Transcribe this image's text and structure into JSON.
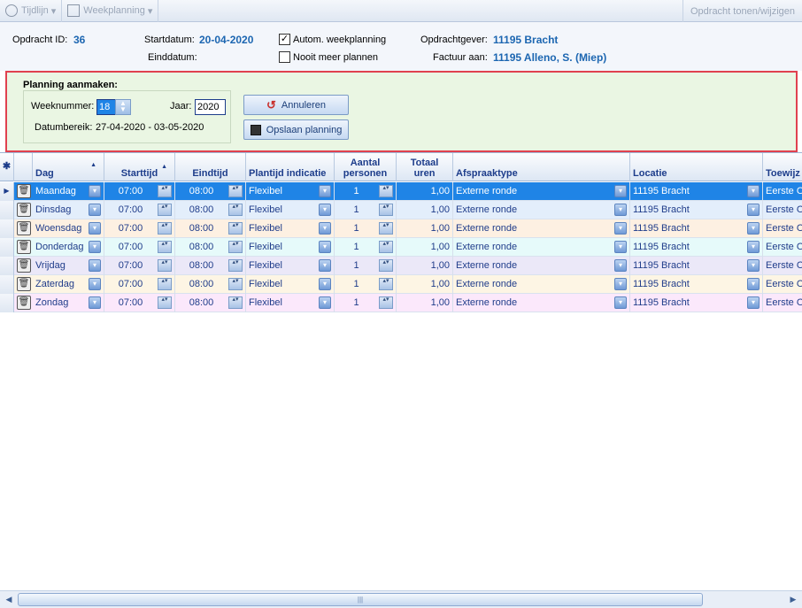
{
  "toolbar": {
    "tijdlijn": "Tijdlijn",
    "weekplanning": "Weekplanning",
    "dropdown_arrow": "▾",
    "opdracht_tonen": "Opdracht tonen/wijzigen"
  },
  "header": {
    "opdracht_id_label": "Opdracht ID:",
    "opdracht_id": "36",
    "startdatum_label": "Startdatum:",
    "startdatum": "20-04-2020",
    "einddatum_label": "Einddatum:",
    "einddatum": "",
    "autom_weekplanning": "Autom. weekplanning",
    "autom_checked": "✓",
    "nooit_meer_plannen": "Nooit meer plannen",
    "opdrachtgever_label": "Opdrachtgever:",
    "opdrachtgever": "11195 Bracht",
    "factuur_label": "Factuur aan:",
    "factuur": "11195 Alleno, S.  (Miep)"
  },
  "planning": {
    "title": "Planning aanmaken:",
    "weeknummer_label": "Weeknummer:",
    "weeknummer": "18",
    "jaar_label": "Jaar:",
    "jaar": "2020",
    "datumbereik_label": "Datumbereik:",
    "datumbereik": "27-04-2020 - 03-05-2020",
    "annuleren": "Annuleren",
    "opslaan": "Opslaan planning"
  },
  "grid": {
    "columns": {
      "dag": "Dag",
      "starttijd": "Starttijd",
      "eindtijd": "Eindtijd",
      "plantijd": "Plantijd indicatie",
      "aantal_1": "Aantal",
      "aantal_2": "personen",
      "totaal_1": "Totaal",
      "totaal_2": "uren",
      "afspraaktype": "Afspraaktype",
      "locatie": "Locatie",
      "toewijzing": "Toewijz"
    },
    "corner_icon": "✱",
    "sort_icon": "▲",
    "row_pointer": "▶",
    "trash_icon": "🗑",
    "dropdown_icon": "▾",
    "spin_icon": "▴▾",
    "rows": [
      {
        "dag": "Maandag",
        "start": "07:00",
        "eind": "08:00",
        "plantijd": "Flexibel",
        "aantal": "1",
        "uren": "1,00",
        "afspraak": "Externe ronde",
        "locatie": "11195 Bracht",
        "toewijzing": "Eerste O",
        "bg": "#1f84e6"
      },
      {
        "dag": "Dinsdag",
        "start": "07:00",
        "eind": "08:00",
        "plantijd": "Flexibel",
        "aantal": "1",
        "uren": "1,00",
        "afspraak": "Externe ronde",
        "locatie": "11195 Bracht",
        "toewijzing": "Eerste O",
        "bg": "#e3eefb"
      },
      {
        "dag": "Woensdag",
        "start": "07:00",
        "eind": "08:00",
        "plantijd": "Flexibel",
        "aantal": "1",
        "uren": "1,00",
        "afspraak": "Externe ronde",
        "locatie": "11195 Bracht",
        "toewijzing": "Eerste O",
        "bg": "#fdf0e2"
      },
      {
        "dag": "Donderdag",
        "start": "07:00",
        "eind": "08:00",
        "plantijd": "Flexibel",
        "aantal": "1",
        "uren": "1,00",
        "afspraak": "Externe ronde",
        "locatie": "11195 Bracht",
        "toewijzing": "Eerste O",
        "bg": "#e6fafa"
      },
      {
        "dag": "Vrijdag",
        "start": "07:00",
        "eind": "08:00",
        "plantijd": "Flexibel",
        "aantal": "1",
        "uren": "1,00",
        "afspraak": "Externe ronde",
        "locatie": "11195 Bracht",
        "toewijzing": "Eerste O",
        "bg": "#ebe8f8"
      },
      {
        "dag": "Zaterdag",
        "start": "07:00",
        "eind": "08:00",
        "plantijd": "Flexibel",
        "aantal": "1",
        "uren": "1,00",
        "afspraak": "Externe ronde",
        "locatie": "11195 Bracht",
        "toewijzing": "Eerste O",
        "bg": "#fdf5e4"
      },
      {
        "dag": "Zondag",
        "start": "07:00",
        "eind": "08:00",
        "plantijd": "Flexibel",
        "aantal": "1",
        "uren": "1,00",
        "afspraak": "Externe ronde",
        "locatie": "11195 Bracht",
        "toewijzing": "Eerste O",
        "bg": "#fbe8fb"
      }
    ]
  },
  "scrollbar": {
    "left_arrow": "◀",
    "right_arrow": "▶",
    "grip": "|||"
  },
  "colors": {
    "accent": "#1c66b1",
    "highlight_border": "#e0414f",
    "selected_row": "#1f84e6"
  }
}
